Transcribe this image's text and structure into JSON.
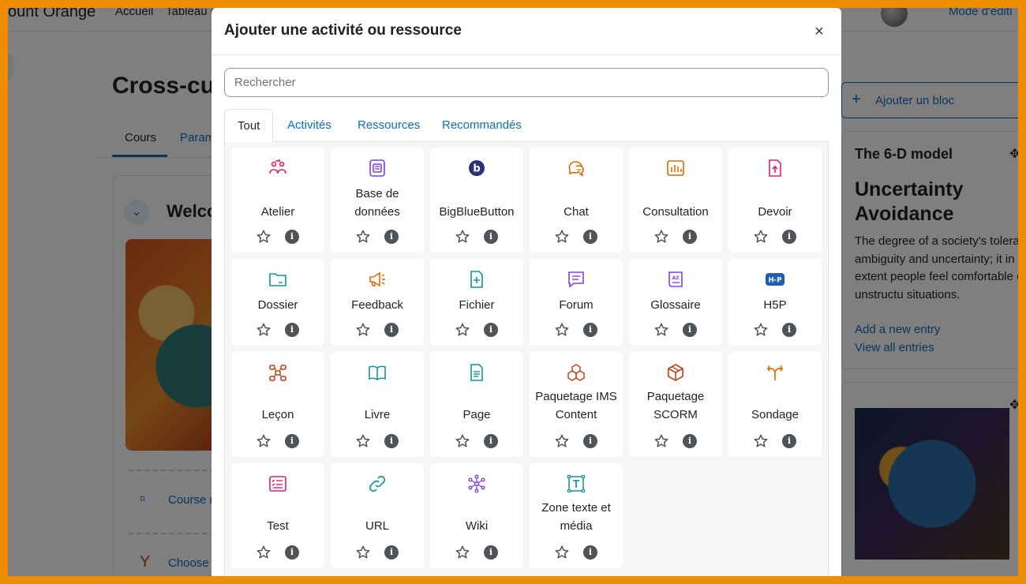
{
  "background": {
    "site_name": "ount Orange",
    "nav": [
      "Accueil",
      "Tableau d"
    ],
    "edit_mode": "Mode d'éditi",
    "course_title": "Cross-cul",
    "course_tabs": [
      "Cours",
      "Param"
    ],
    "section_title": "Welco",
    "activities": [
      "Course n",
      "Choose s"
    ],
    "add_block": "Ajouter un bloc",
    "glossary_block": {
      "title": "The 6-D model",
      "term": "Uncertainty Avoidance",
      "definition": "The degree of a society's tolera ambiguity and uncertainty; it in to what extent people feel comfortable or not in unstructu situations.",
      "links": [
        "Add a new entry",
        "View all entries"
      ]
    }
  },
  "modal": {
    "title": "Ajouter une activité ou ressource",
    "close_label": "×",
    "search_placeholder": "Rechercher",
    "search_value": "",
    "tabs": [
      "Tout",
      "Activités",
      "Ressources",
      "Recommandés"
    ],
    "active_tab": "Tout",
    "items": [
      {
        "label": "Atelier",
        "icon": "workshop-icon",
        "color": "#d6246c"
      },
      {
        "label": "Base de données",
        "icon": "database-icon",
        "color": "#7f3ee5"
      },
      {
        "label": "BigBlueButton",
        "icon": "bigbluebutton-icon",
        "color": "#283274"
      },
      {
        "label": "Chat",
        "icon": "chat-icon",
        "color": "#e06a00"
      },
      {
        "label": "Consultation",
        "icon": "feedback-chart-icon",
        "color": "#e06a00"
      },
      {
        "label": "Devoir",
        "icon": "assignment-icon",
        "color": "#d6246c"
      },
      {
        "label": "Dossier",
        "icon": "folder-icon",
        "color": "#11949b"
      },
      {
        "label": "Feedback",
        "icon": "megaphone-icon",
        "color": "#e06a00"
      },
      {
        "label": "Fichier",
        "icon": "file-icon",
        "color": "#11949b"
      },
      {
        "label": "Forum",
        "icon": "forum-icon",
        "color": "#7f3ee5"
      },
      {
        "label": "Glossaire",
        "icon": "glossary-icon",
        "color": "#7f3ee5"
      },
      {
        "label": "H5P",
        "icon": "h5p-icon",
        "color": "#1f5fb1"
      },
      {
        "label": "Leçon",
        "icon": "lesson-icon",
        "color": "#c0431b"
      },
      {
        "label": "Livre",
        "icon": "book-icon",
        "color": "#11949b"
      },
      {
        "label": "Page",
        "icon": "page-icon",
        "color": "#11949b"
      },
      {
        "label": "Paquetage IMS Content",
        "icon": "ims-package-icon",
        "color": "#c0431b"
      },
      {
        "label": "Paquetage SCORM",
        "icon": "scorm-package-icon",
        "color": "#c0431b"
      },
      {
        "label": "Sondage",
        "icon": "choice-icon",
        "color": "#e06a00"
      },
      {
        "label": "Test",
        "icon": "quiz-icon",
        "color": "#d6246c"
      },
      {
        "label": "URL",
        "icon": "link-icon",
        "color": "#11949b"
      },
      {
        "label": "Wiki",
        "icon": "wiki-icon",
        "color": "#7f3ee5"
      },
      {
        "label": "Zone texte et média",
        "icon": "text-media-icon",
        "color": "#11949b"
      }
    ],
    "info_glyph": "i"
  }
}
